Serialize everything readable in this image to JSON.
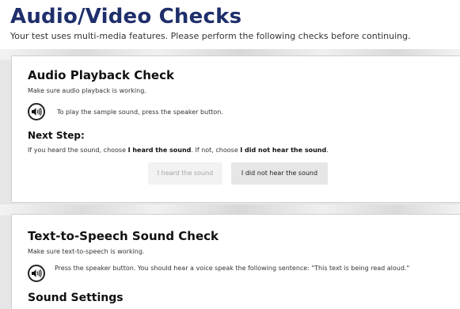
{
  "header": {
    "title": "Audio/Video Checks",
    "subtitle": "Your test uses multi-media features. Please perform the following checks before continuing."
  },
  "audio_check": {
    "title": "Audio Playback Check",
    "description": "Make sure audio playback is working.",
    "instruction": "To play the sample sound, press the speaker button.",
    "next_step_title": "Next Step:",
    "next_step_text_1": "If you heard the sound, choose ",
    "next_step_bold_1": "I heard the sound",
    "next_step_text_2": ". If not, choose ",
    "next_step_bold_2": "I did not hear the sound",
    "next_step_text_3": ".",
    "heard_button": "I heard the sound",
    "not_heard_button": "I did not hear the sound"
  },
  "tts_check": {
    "title": "Text-to-Speech Sound Check",
    "description": "Make sure text-to-speech is working.",
    "instruction": "Press the speaker button. You should hear a voice speak the following sentence: \"This text is being read aloud.\"",
    "settings_title": "Sound Settings"
  },
  "icons": {
    "speaker": "speaker-icon"
  }
}
